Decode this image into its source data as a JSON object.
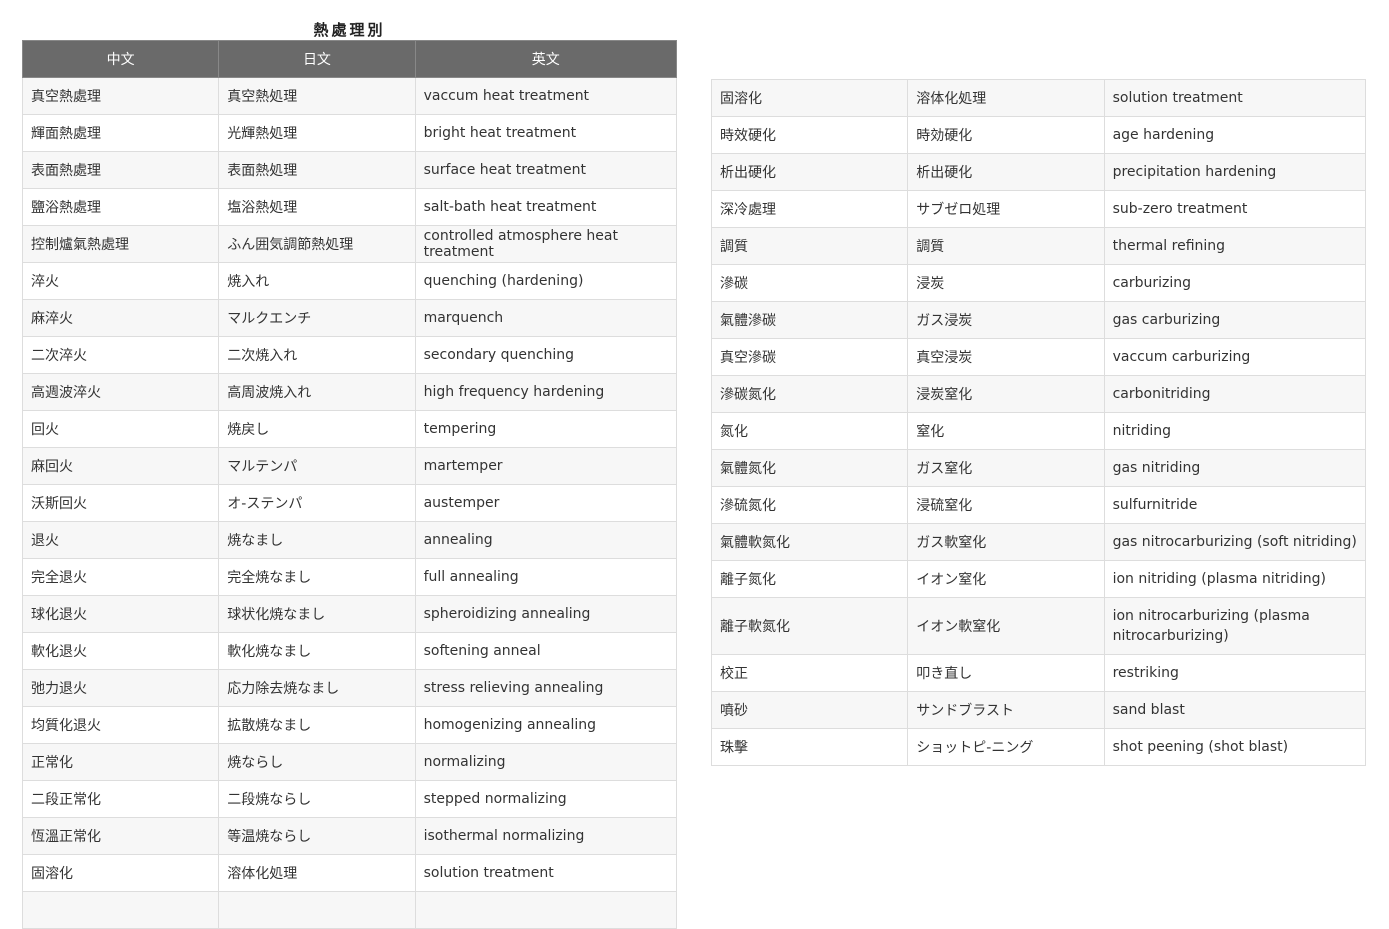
{
  "title": "熱處理別",
  "headers": {
    "zh": "中文",
    "ja": "日文",
    "en": "英文"
  },
  "left_rows": [
    {
      "zh": "真空熱處理",
      "ja": "真空熱処理",
      "en": "vaccum heat treatment"
    },
    {
      "zh": "輝面熱處理",
      "ja": "光輝熱処理",
      "en": "bright heat treatment"
    },
    {
      "zh": "表面熱處理",
      "ja": "表面熱処理",
      "en": "surface heat treatment"
    },
    {
      "zh": "鹽浴熱處理",
      "ja": "塩浴熱処理",
      "en": "salt-bath heat treatment"
    },
    {
      "zh": "控制爐氣熱處理",
      "ja": "ふん囲気調節熱処理",
      "en": "controlled atmosphere heat treatment"
    },
    {
      "zh": "淬火",
      "ja": "焼入れ",
      "en": "quenching (hardening)"
    },
    {
      "zh": "麻淬火",
      "ja": "マルクエンチ",
      "en": "marquench"
    },
    {
      "zh": "二次淬火",
      "ja": "二次焼入れ",
      "en": "secondary quenching"
    },
    {
      "zh": "高週波淬火",
      "ja": "高周波焼入れ",
      "en": "high frequency hardening"
    },
    {
      "zh": "回火",
      "ja": "焼戻し",
      "en": "tempering"
    },
    {
      "zh": "麻回火",
      "ja": "マルテンパ",
      "en": "martemper"
    },
    {
      "zh": "沃斯回火",
      "ja": "オ-ステンパ",
      "en": "austemper"
    },
    {
      "zh": "退火",
      "ja": "焼なまし",
      "en": "annealing"
    },
    {
      "zh": "完全退火",
      "ja": "完全焼なまし",
      "en": "full annealing"
    },
    {
      "zh": "球化退火",
      "ja": "球状化焼なまし",
      "en": "spheroidizing annealing"
    },
    {
      "zh": "軟化退火",
      "ja": "軟化焼なまし",
      "en": "softening anneal"
    },
    {
      "zh": "弛力退火",
      "ja": "応力除去焼なまし",
      "en": "stress relieving annealing"
    },
    {
      "zh": "均質化退火",
      "ja": "拡散焼なまし",
      "en": "homogenizing annealing"
    },
    {
      "zh": "正常化",
      "ja": "焼ならし",
      "en": "normalizing"
    },
    {
      "zh": "二段正常化",
      "ja": "二段焼ならし",
      "en": "stepped normalizing"
    },
    {
      "zh": "恆溫正常化",
      "ja": "等温焼ならし",
      "en": "isothermal normalizing"
    },
    {
      "zh": "固溶化",
      "ja": "溶体化処理",
      "en": "solution treatment"
    },
    {
      "zh": "",
      "ja": "",
      "en": ""
    }
  ],
  "right_rows": [
    {
      "zh": "固溶化",
      "ja": "溶体化処理",
      "en": "solution treatment"
    },
    {
      "zh": "時效硬化",
      "ja": "時効硬化",
      "en": "age hardening"
    },
    {
      "zh": "析出硬化",
      "ja": "析出硬化",
      "en": "precipitation hardening"
    },
    {
      "zh": "深冷處理",
      "ja": "サブゼロ処理",
      "en": "sub-zero treatment"
    },
    {
      "zh": "調質",
      "ja": "調質",
      "en": "thermal refining"
    },
    {
      "zh": "滲碳",
      "ja": "浸炭",
      "en": "carburizing"
    },
    {
      "zh": "氣體滲碳",
      "ja": "ガス浸炭",
      "en": "gas carburizing"
    },
    {
      "zh": "真空滲碳",
      "ja": "真空浸炭",
      "en": "vaccum carburizing"
    },
    {
      "zh": "滲碳氮化",
      "ja": "浸炭窒化",
      "en": "carbonitriding"
    },
    {
      "zh": "氮化",
      "ja": "窒化",
      "en": "nitriding"
    },
    {
      "zh": "氣體氮化",
      "ja": "ガス窒化",
      "en": "gas nitriding"
    },
    {
      "zh": "滲硫氮化",
      "ja": "浸硫窒化",
      "en": "sulfurnitride"
    },
    {
      "zh": "氣體軟氮化",
      "ja": "ガス軟窒化",
      "en": "gas nitrocarburizing (soft nitriding)"
    },
    {
      "zh": "離子氮化",
      "ja": "イオン窒化",
      "en": "ion nitriding (plasma nitriding)"
    },
    {
      "zh": "離子軟氮化",
      "ja": "イオン軟窒化",
      "en": "ion nitrocarburizing (plasma nitrocarburizing)",
      "tall": true
    },
    {
      "zh": "校正",
      "ja": "叩き直し",
      "en": "restriking"
    },
    {
      "zh": "噴砂",
      "ja": "サンドブラスト",
      "en": "sand blast"
    },
    {
      "zh": "珠擊",
      "ja": "ショットピ-ニング",
      "en": "shot peening (shot blast)"
    }
  ],
  "colors": {
    "header_bg": "#6a6a6a",
    "header_text": "#ffffff",
    "row_odd": "#f7f7f7",
    "row_even": "#ffffff",
    "border": "#dddddd"
  }
}
